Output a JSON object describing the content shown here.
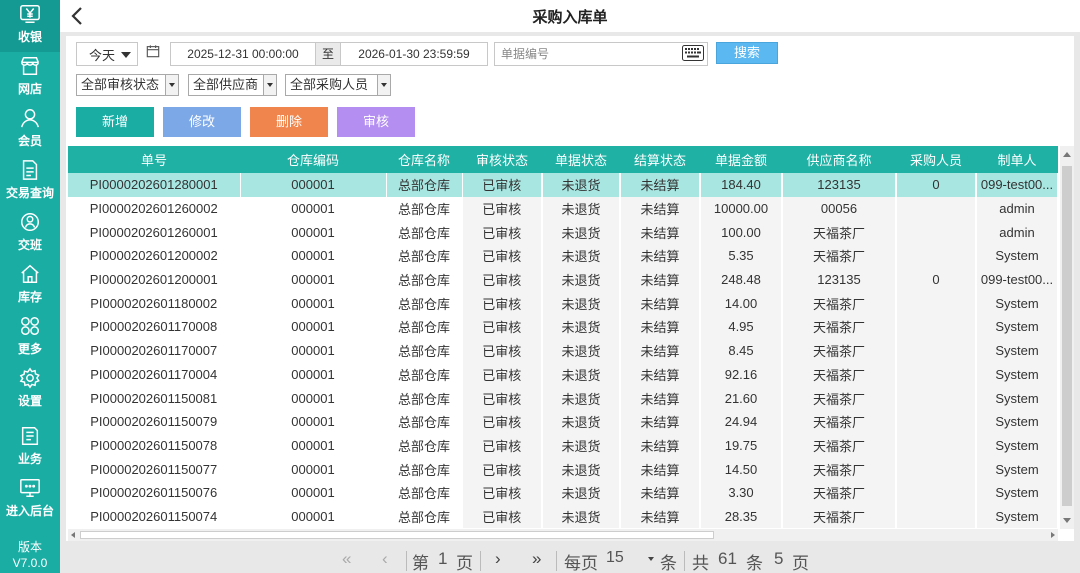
{
  "header": {
    "title": "采购入库单"
  },
  "sidebar": {
    "items": [
      {
        "label": "收银",
        "icon": "yen-icon"
      },
      {
        "label": "网店",
        "icon": "shop-icon"
      },
      {
        "label": "会员",
        "icon": "member-icon"
      },
      {
        "label": "交易查询",
        "icon": "document-icon"
      },
      {
        "label": "交班",
        "icon": "handover-icon"
      },
      {
        "label": "库存",
        "icon": "home-icon"
      },
      {
        "label": "更多",
        "icon": "grid-icon"
      },
      {
        "label": "设置",
        "icon": "gear-icon"
      },
      {
        "label": "业务",
        "icon": "book-icon"
      },
      {
        "label": "进入后台",
        "icon": "monitor-icon"
      }
    ],
    "version_label": "版本",
    "version": "V7.0.0"
  },
  "filters": {
    "date_range": "今天",
    "start": "2025-12-31 00:00:00",
    "to": "至",
    "end": "2026-01-30 23:59:59",
    "doc_placeholder": "单据编号",
    "search": "搜索",
    "audit_status": "全部审核状态",
    "supplier": "全部供应商",
    "purchaser": "全部采购人员"
  },
  "actions": {
    "add": "新增",
    "edit": "修改",
    "delete": "删除",
    "audit": "审核"
  },
  "table": {
    "columns": [
      "单号",
      "仓库编码",
      "仓库名称",
      "审核状态",
      "单据状态",
      "结算状态",
      "单据金额",
      "供应商名称",
      "采购人员",
      "制单人"
    ],
    "rows": [
      [
        "PI0000202601280001",
        "000001",
        "总部仓库",
        "已审核",
        "未退货",
        "未结算",
        "184.40",
        "123135",
        "0",
        "099-test00..."
      ],
      [
        "PI0000202601260002",
        "000001",
        "总部仓库",
        "已审核",
        "未退货",
        "未结算",
        "10000.00",
        "00056",
        "",
        "admin"
      ],
      [
        "PI0000202601260001",
        "000001",
        "总部仓库",
        "已审核",
        "未退货",
        "未结算",
        "100.00",
        "天福茶厂",
        "",
        "admin"
      ],
      [
        "PI0000202601200002",
        "000001",
        "总部仓库",
        "已审核",
        "未退货",
        "未结算",
        "5.35",
        "天福茶厂",
        "",
        "System"
      ],
      [
        "PI0000202601200001",
        "000001",
        "总部仓库",
        "已审核",
        "未退货",
        "未结算",
        "248.48",
        "123135",
        "0",
        "099-test00..."
      ],
      [
        "PI0000202601180002",
        "000001",
        "总部仓库",
        "已审核",
        "未退货",
        "未结算",
        "14.00",
        "天福茶厂",
        "",
        "System"
      ],
      [
        "PI0000202601170008",
        "000001",
        "总部仓库",
        "已审核",
        "未退货",
        "未结算",
        "4.95",
        "天福茶厂",
        "",
        "System"
      ],
      [
        "PI0000202601170007",
        "000001",
        "总部仓库",
        "已审核",
        "未退货",
        "未结算",
        "8.45",
        "天福茶厂",
        "",
        "System"
      ],
      [
        "PI0000202601170004",
        "000001",
        "总部仓库",
        "已审核",
        "未退货",
        "未结算",
        "92.16",
        "天福茶厂",
        "",
        "System"
      ],
      [
        "PI0000202601150081",
        "000001",
        "总部仓库",
        "已审核",
        "未退货",
        "未结算",
        "21.60",
        "天福茶厂",
        "",
        "System"
      ],
      [
        "PI0000202601150079",
        "000001",
        "总部仓库",
        "已审核",
        "未退货",
        "未结算",
        "24.94",
        "天福茶厂",
        "",
        "System"
      ],
      [
        "PI0000202601150078",
        "000001",
        "总部仓库",
        "已审核",
        "未退货",
        "未结算",
        "19.75",
        "天福茶厂",
        "",
        "System"
      ],
      [
        "PI0000202601150077",
        "000001",
        "总部仓库",
        "已审核",
        "未退货",
        "未结算",
        "14.50",
        "天福茶厂",
        "",
        "System"
      ],
      [
        "PI0000202601150076",
        "000001",
        "总部仓库",
        "已审核",
        "未退货",
        "未结算",
        "3.30",
        "天福茶厂",
        "",
        "System"
      ],
      [
        "PI0000202601150074",
        "000001",
        "总部仓库",
        "已审核",
        "未退货",
        "未结算",
        "28.35",
        "天福茶厂",
        "",
        "System"
      ]
    ]
  },
  "pager": {
    "first": "«",
    "prev": "‹",
    "page_prefix": "第",
    "page": "1",
    "page_suffix": "页",
    "next": "›",
    "last": "»",
    "per_page_label": "每页",
    "per_page": "15",
    "per_page_unit": "条",
    "total_prefix": "共",
    "total": "61",
    "total_unit": "条",
    "pages": "5",
    "pages_unit": "页"
  },
  "colors": {
    "accent": "#1aada4",
    "header_row": "#1fb1a4",
    "selected_row": "#a8e6e2"
  }
}
